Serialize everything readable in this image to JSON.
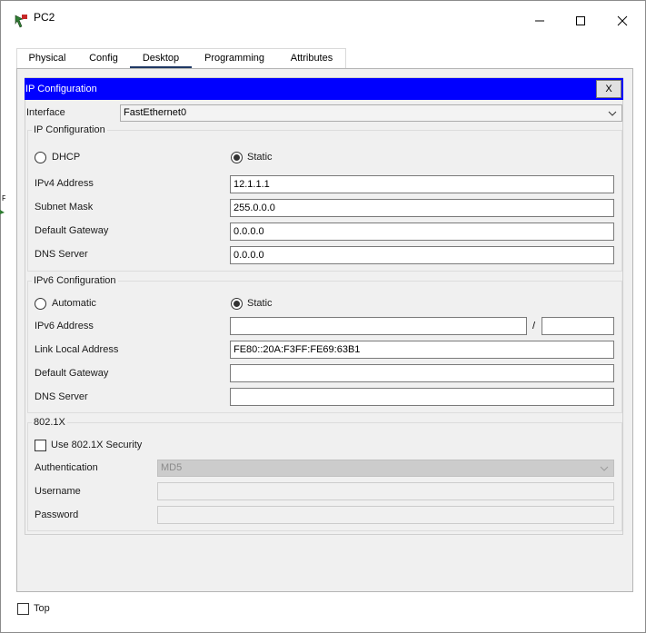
{
  "window": {
    "title": "PC2",
    "icon": "packet-tracer-pc-icon",
    "controls": [
      "minimize-icon",
      "maximize-icon",
      "close-icon"
    ]
  },
  "tabs": [
    {
      "label": "Physical",
      "active": false
    },
    {
      "label": "Config",
      "active": false
    },
    {
      "label": "Desktop",
      "active": true
    },
    {
      "label": "Programming",
      "active": false
    },
    {
      "label": "Attributes",
      "active": false
    }
  ],
  "panel": {
    "title": "IP Configuration",
    "close_label": "X",
    "header_color": "#0000ff"
  },
  "interface": {
    "label": "Interface",
    "value": "FastEthernet0"
  },
  "ipv4": {
    "group_title": "IP Configuration",
    "dhcp_label": "DHCP",
    "static_label": "Static",
    "mode": "Static",
    "address_label": "IPv4 Address",
    "address": "12.1.1.1",
    "mask_label": "Subnet Mask",
    "mask": "255.0.0.0",
    "gateway_label": "Default Gateway",
    "gateway": "0.0.0.0",
    "dns_label": "DNS Server",
    "dns": "0.0.0.0"
  },
  "ipv6": {
    "group_title": "IPv6 Configuration",
    "auto_label": "Automatic",
    "static_label": "Static",
    "mode": "Static",
    "address_label": "IPv6 Address",
    "address": "",
    "separator": "/",
    "prefix": "",
    "link_local_label": "Link Local Address",
    "link_local": "FE80::20A:F3FF:FE69:63B1",
    "gateway_label": "Default Gateway",
    "gateway": "",
    "dns_label": "DNS Server",
    "dns": ""
  },
  "dot1x": {
    "group_title": "802.1X",
    "use_label": "Use 802.1X Security",
    "use_checked": false,
    "auth_label": "Authentication",
    "auth_value": "MD5",
    "username_label": "Username",
    "username": "",
    "password_label": "Password",
    "password": ""
  },
  "footer": {
    "top_label": "Top",
    "top_checked": false
  }
}
